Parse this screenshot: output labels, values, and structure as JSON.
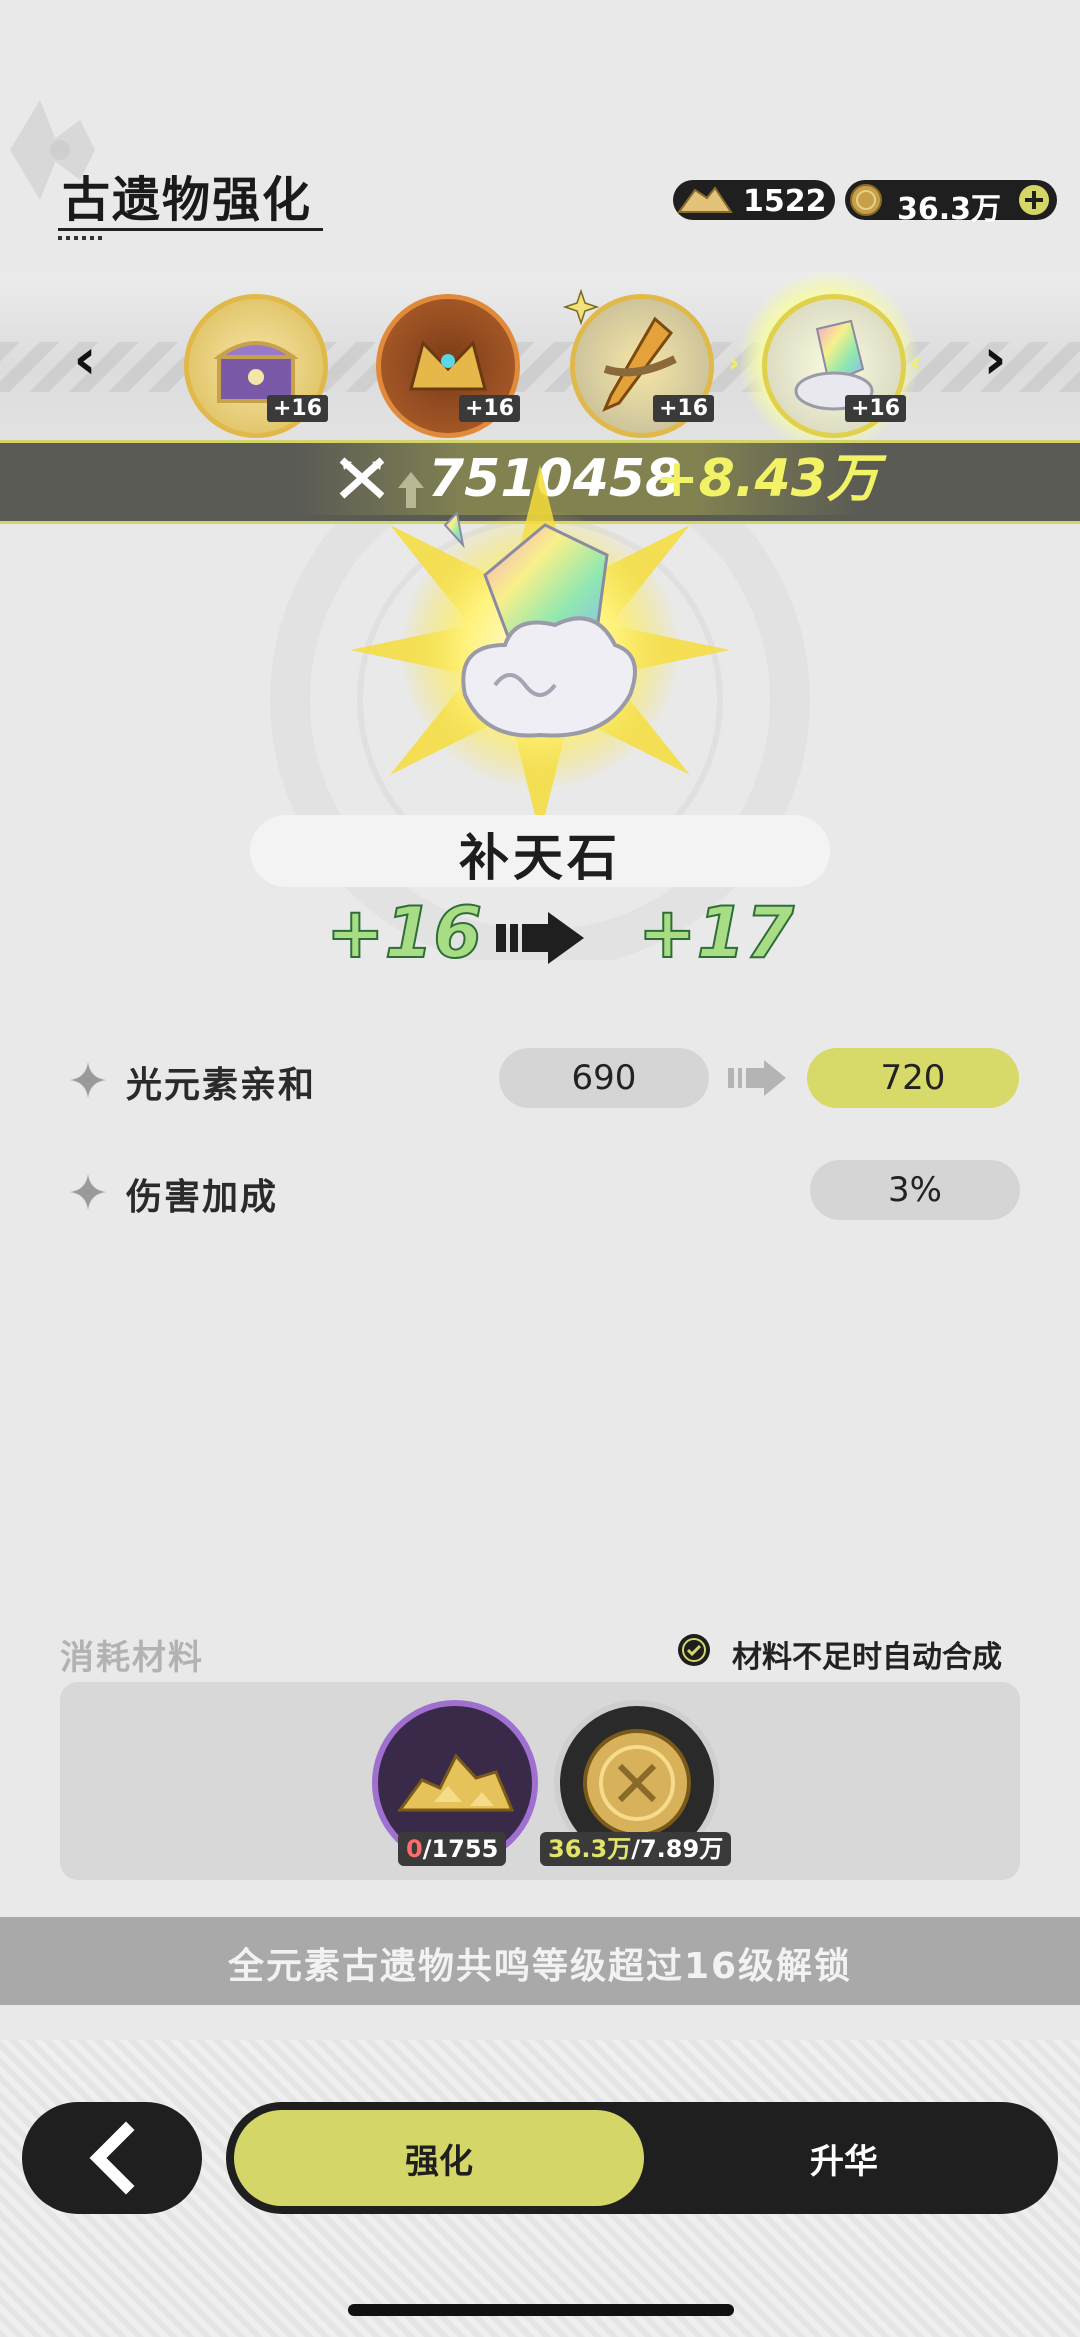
{
  "header": {
    "title": "古遗物强化",
    "currencies": [
      {
        "icon": "ore-pile-icon",
        "value": "1522"
      },
      {
        "icon": "gold-coin-icon",
        "value": "36.3万"
      }
    ]
  },
  "relics": [
    {
      "icon": "purple-chest-relic-icon",
      "level": "+16"
    },
    {
      "icon": "golden-crown-relic-icon",
      "level": "+16"
    },
    {
      "icon": "golden-spear-relic-icon",
      "level": "+16"
    },
    {
      "icon": "rainbow-crystal-relic-icon",
      "level": "+16",
      "selected": true
    }
  ],
  "power": {
    "value": "7510458",
    "delta": "+8.43万"
  },
  "relic": {
    "name": "补天石",
    "level_from": "+16",
    "level_to": "+17"
  },
  "stats": [
    {
      "label": "光元素亲和",
      "current": "690",
      "next": "720"
    },
    {
      "label": "伤害加成",
      "current": "3%"
    }
  ],
  "materials": {
    "title": "消耗材料",
    "auto_label": "材料不足时自动合成",
    "items": [
      {
        "icon": "gold-ore-icon",
        "have": "0",
        "need": "/1755"
      },
      {
        "icon": "gold-coin-icon",
        "have": "36.3万",
        "need": "/7.89万"
      }
    ]
  },
  "lock_message": "全元素古遗物共鸣等级超过16级解锁",
  "tabs": {
    "enhance": "强化",
    "ascend": "升华"
  },
  "colors": {
    "accent": "#d4d668",
    "dark": "#1f1f1f",
    "level_green": "#a8dd86"
  }
}
